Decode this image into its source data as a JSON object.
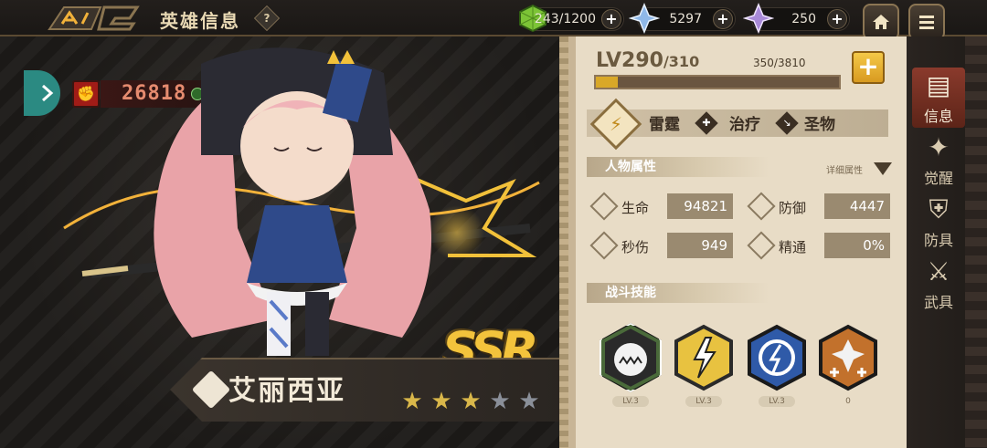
{
  "header": {
    "title": "英雄信息",
    "help_label": "?"
  },
  "resources": [
    {
      "icon": "stamina-cube-icon",
      "value": "243/1200",
      "add_label": "+"
    },
    {
      "icon": "blue-crystal-icon",
      "value": "5297",
      "add_label": "+"
    },
    {
      "icon": "purple-crystal-icon",
      "value": "250",
      "add_label": "+"
    }
  ],
  "nav": {
    "home_icon": "home-icon",
    "menu_icon": "menu-icon"
  },
  "hero": {
    "power": "26818",
    "rarity": "SSR",
    "name": "艾丽西亚",
    "stars_total": 5,
    "stars_filled": 3,
    "colors": {
      "star_filled": "#d9b74a",
      "star_empty": "#8a8f99"
    }
  },
  "level": {
    "current": "LV290",
    "max": "/310",
    "exp_text": "350/3810",
    "exp_fraction": 0.092,
    "add_label": "+"
  },
  "tags": {
    "element": "雷霆",
    "role": "治疗",
    "type": "圣物"
  },
  "attributes": {
    "section_title": "人物属性",
    "detail_label": "详细属性",
    "items": [
      {
        "label": "生命",
        "value": "94821"
      },
      {
        "label": "防御",
        "value": "4447"
      },
      {
        "label": "秒伤",
        "value": "949"
      },
      {
        "label": "精通",
        "value": "0%"
      }
    ]
  },
  "skills": {
    "section_title": "战斗技能",
    "items": [
      {
        "icon": "monster-skill-icon",
        "level": "LV.3"
      },
      {
        "icon": "lightning-skill-icon",
        "level": "LV.3"
      },
      {
        "icon": "storm-skill-icon",
        "level": "LV.3"
      },
      {
        "icon": "heal-skill-icon",
        "level": "0"
      }
    ]
  },
  "sidebar": {
    "items": [
      {
        "label": "信息",
        "icon": "book-icon"
      },
      {
        "label": "觉醒",
        "icon": "awaken-icon"
      },
      {
        "label": "防具",
        "icon": "armor-icon"
      },
      {
        "label": "武具",
        "icon": "weapon-icon"
      }
    ]
  }
}
